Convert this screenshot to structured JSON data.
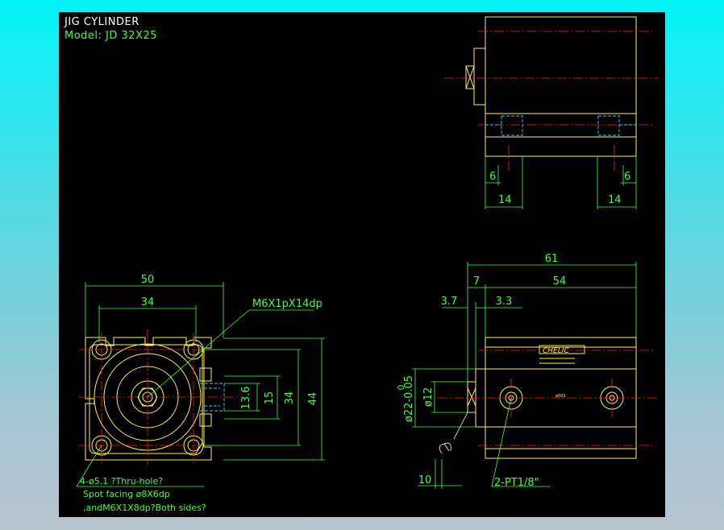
{
  "title": "JIG CYLINDER",
  "model": "Model: JD  32X25",
  "colors": {
    "outline": "#ffee66",
    "dimension": "#40ff40",
    "centerline": "#ff2020",
    "hidden": "#40c8ff",
    "background": "#000000"
  },
  "top_view": {
    "dim_left_6": "6",
    "dim_left_14": "14",
    "dim_right_6": "6",
    "dim_right_14": "14"
  },
  "front_view": {
    "dim_50": "50",
    "dim_34": "34",
    "dim_13_6": "13.6",
    "dim_15": "15",
    "dim_34_v": "34",
    "dim_44": "44",
    "thread_label": "M6X1pX14dp",
    "note_line1": "4-ø5.1 ?Thru-hole?",
    "note_line2": "Spot facing  ø8X6dp",
    "note_line3": ",andM6X1X8dp?Both sides?"
  },
  "side_view": {
    "dim_61": "61",
    "dim_7": "7",
    "dim_54": "54",
    "dim_3_7": "3.7",
    "dim_3_3": "3.3",
    "dim_phi12": "ø12",
    "dim_phi22": "ø22-0.05",
    "dim_phi22_sup": "0",
    "dim_10": "10",
    "port_label": "2-PT1/8\"",
    "brand": "CHELIC",
    "bore_mark": "ø003"
  }
}
